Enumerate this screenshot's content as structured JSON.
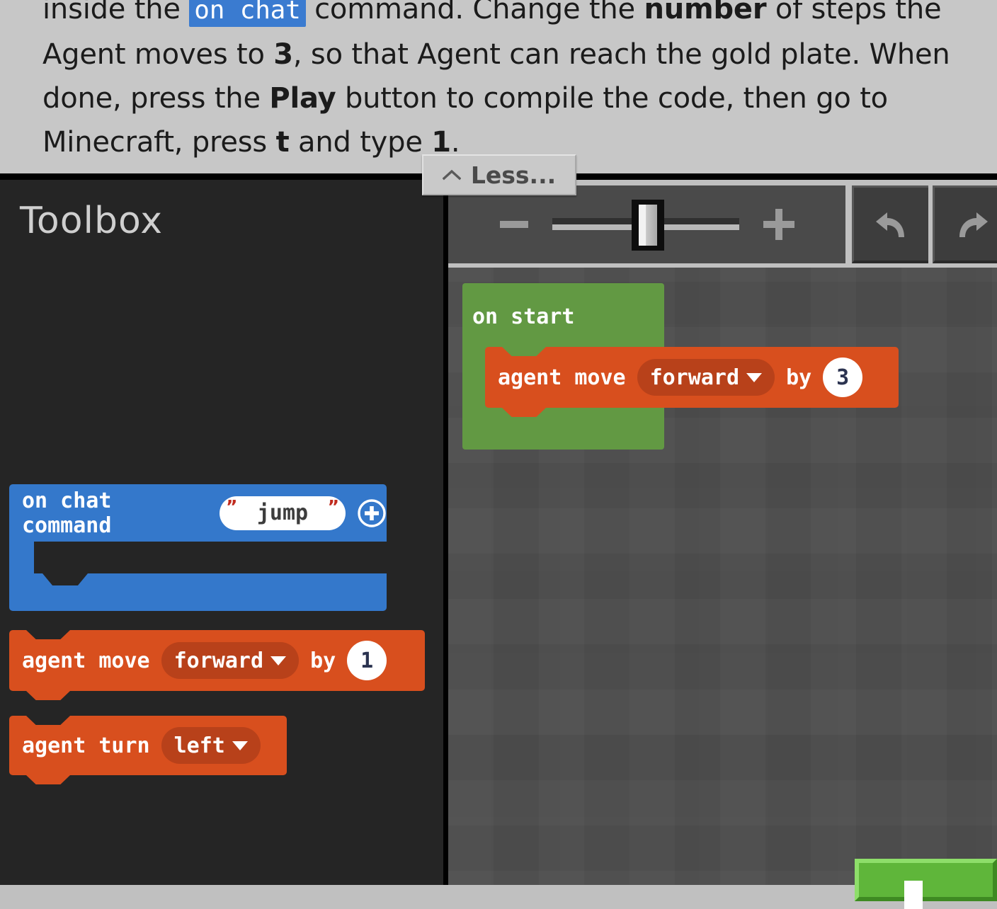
{
  "tutorial": {
    "text_before_code": "inside the ",
    "code_chip": "on chat",
    "text_after_code": " command. Change the ",
    "bold_1": "number",
    "text_2": " of steps the Agent moves to ",
    "bold_2": "3",
    "text_3": ", so that Agent can reach the gold plate. When done, press the ",
    "bold_3": "Play",
    "text_4": " button to compile the code, then go to Minecraft, press ",
    "bold_4": "t",
    "text_5": " and type ",
    "bold_5": "1",
    "text_6": "."
  },
  "less_button": {
    "label": "Less...",
    "icon": "chevron-up-icon"
  },
  "toolbox": {
    "title": "Toolbox",
    "blocks": [
      {
        "id": "on-chat-command",
        "type": "event-hat",
        "color": "#3478cb",
        "label": "on chat command",
        "text_field_value": "jump",
        "quote_color": "#c02b1e",
        "add_icon": "plus-circle-icon"
      },
      {
        "id": "agent-move",
        "type": "statement",
        "color": "#d84f1e",
        "label_left": "agent move",
        "dropdown_value": "forward",
        "dropdown_icon": "chevron-down-icon",
        "label_mid": "by",
        "number_value": "1"
      },
      {
        "id": "agent-turn",
        "type": "statement",
        "color": "#d84f1e",
        "label_left": "agent turn",
        "dropdown_value": "left",
        "dropdown_icon": "chevron-down-icon"
      }
    ]
  },
  "toolbar": {
    "zoom_out_icon": "minus-icon",
    "zoom_in_icon": "plus-icon",
    "zoom_slider_position_percent": 50,
    "undo_icon": "undo-arrow-icon",
    "redo_icon": "redo-arrow-icon"
  },
  "workspace": {
    "background_color": "#4c4c4c",
    "blocks": [
      {
        "id": "on-start",
        "type": "event-hat",
        "color": "#629943",
        "label": "on start"
      },
      {
        "id": "agent-move-ws",
        "type": "statement",
        "color": "#d84f1e",
        "label_left": "agent move",
        "dropdown_value": "forward",
        "dropdown_icon": "chevron-down-icon",
        "label_mid": "by",
        "number_value": "3"
      }
    ]
  },
  "play_button": {
    "color": "#5fb63a",
    "icon": "play-icon"
  }
}
